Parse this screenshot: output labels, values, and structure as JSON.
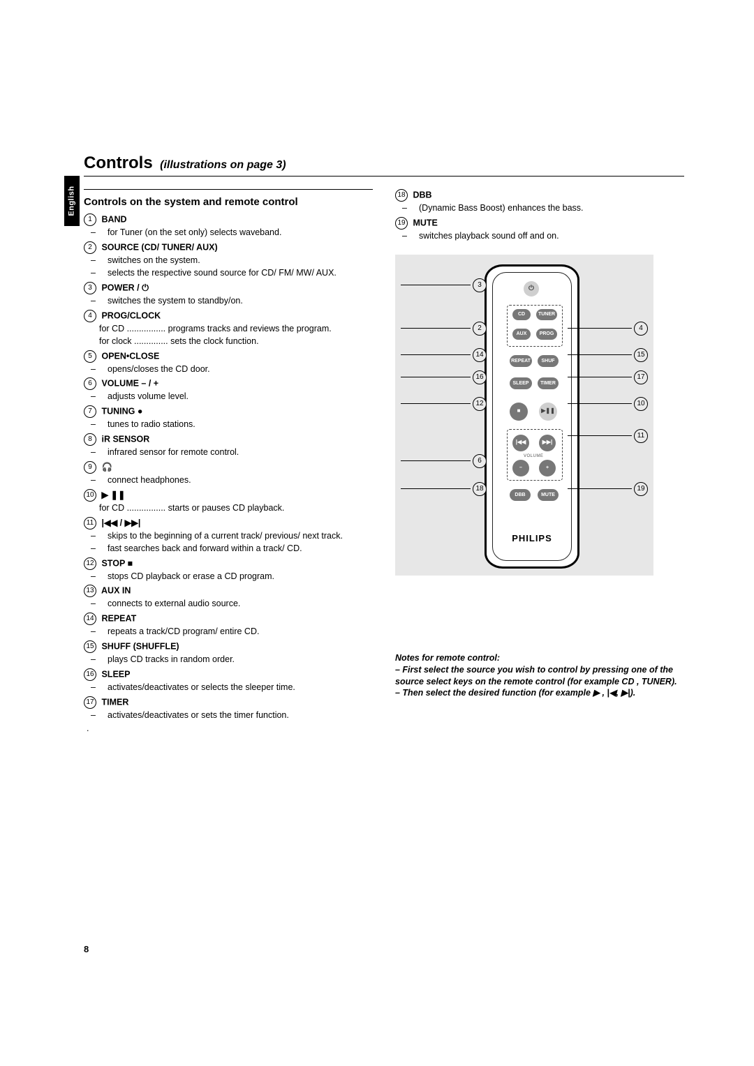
{
  "tab": "English",
  "title": "Controls",
  "subtitle": "(illustrations on page 3)",
  "section_heading": "Controls on the system and remote control",
  "items_left": [
    {
      "num": "1",
      "label": "BAND",
      "extra": "",
      "subs": [
        "for Tuner (on the set only) selects waveband."
      ]
    },
    {
      "num": "2",
      "label": "SOURCE (CD/ TUNER/ AUX)",
      "extra": "",
      "subs": [
        "switches on the system.",
        "selects the respective sound source for CD/ FM/ MW/ AUX."
      ]
    },
    {
      "num": "3",
      "label": "POWER /",
      "extra": "⏻",
      "subs": [
        "switches the system to standby/on."
      ]
    },
    {
      "num": "4",
      "label": "PROG/CLOCK",
      "extra": "",
      "subs": [],
      "defs": [
        {
          "k": "for CD ................",
          "v": "programs tracks and reviews the program."
        },
        {
          "k": "for clock ..............",
          "v": "sets the clock function."
        }
      ]
    },
    {
      "num": "5",
      "label": "OPEN•CLOSE",
      "extra": "",
      "subs": [
        "opens/closes the CD door."
      ]
    },
    {
      "num": "6",
      "label": "VOLUME – / +",
      "extra": "",
      "subs": [
        "adjusts volume level."
      ]
    },
    {
      "num": "7",
      "label": "TUNING",
      "extra": "●",
      "subs": [
        "tunes to radio stations."
      ]
    },
    {
      "num": "8",
      "label": "iR SENSOR",
      "extra": "",
      "subs": [
        "infrared sensor for remote control."
      ]
    },
    {
      "num": "9",
      "label": "",
      "extra": "🎧",
      "subs": [
        "connect headphones."
      ]
    },
    {
      "num": "10",
      "label": "",
      "extra": "▶ ❚❚",
      "subs": [],
      "defs": [
        {
          "k": "for CD ................",
          "v": "starts or pauses CD playback."
        }
      ]
    },
    {
      "num": "11",
      "label": "",
      "extra": "|◀◀ / ▶▶|",
      "subs": [
        "skips to the beginning of a current track/ previous/ next track.",
        "fast searches back and forward within a track/ CD."
      ]
    },
    {
      "num": "12",
      "label": "STOP",
      "extra": "■",
      "subs": [
        "stops CD playback or erase a CD program."
      ]
    },
    {
      "num": "13",
      "label": "AUX IN",
      "extra": "",
      "subs": [
        "connects to external audio source."
      ]
    },
    {
      "num": "14",
      "label": "REPEAT",
      "extra": "",
      "subs": [
        "repeats a track/CD program/ entire CD."
      ]
    },
    {
      "num": "15",
      "label": "SHUFF (SHUFFLE)",
      "extra": "",
      "subs": [
        "plays CD tracks in random order."
      ]
    },
    {
      "num": "16",
      "label": "SLEEP",
      "extra": "",
      "subs": [
        "activates/deactivates or selects the sleeper time."
      ]
    },
    {
      "num": "17",
      "label": "TIMER",
      "extra": "",
      "subs": [
        "activates/deactivates or sets the timer function."
      ]
    }
  ],
  "items_right": [
    {
      "num": "18",
      "label": "DBB",
      "extra": "",
      "subs": [
        "(Dynamic Bass Boost) enhances the bass."
      ]
    },
    {
      "num": "19",
      "label": "MUTE",
      "extra": "",
      "subs": [
        "switches playback sound off and on."
      ]
    }
  ],
  "notes": {
    "title": "Notes for remote control:",
    "line1": "–  First select the source you wish to control by pressing one of the source select keys on the remote control (for example CD , TUNER).",
    "line2": "–  Then select the desired function (for example ▶ ,  |◀,  ▶|)."
  },
  "callouts_left": [
    "3",
    "2",
    "14",
    "16",
    "12",
    "6",
    "18"
  ],
  "callouts_right": [
    "4",
    "15",
    "17",
    "10",
    "11",
    "19"
  ],
  "remote_buttons": {
    "cd": "CD",
    "tuner": "TUNER",
    "aux": "AUX",
    "prog": "PROG",
    "repeat": "REPEAT",
    "shuf": "SHUF",
    "sleep": "SLEEP",
    "timer": "TIMER",
    "dbb": "DBB",
    "mute": "MUTE",
    "volume": "VOLUME"
  },
  "brand": "PHILIPS",
  "page_number": "8"
}
